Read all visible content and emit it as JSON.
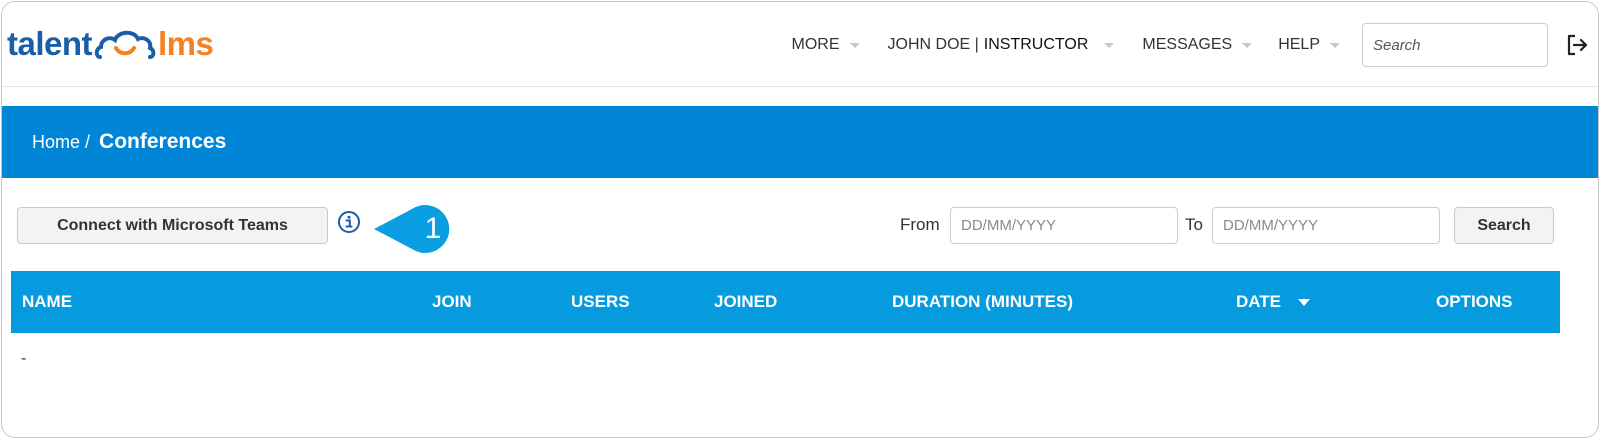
{
  "brand": {
    "part1": "talent",
    "part2": "lms",
    "color_primary": "#1a5ea8",
    "color_accent": "#f58220"
  },
  "nav": {
    "more": "MORE",
    "user": "JOHN DOE |",
    "role": "INSTRUCTOR",
    "messages": "MESSAGES",
    "help": "HELP",
    "search_placeholder": "Search",
    "logout_icon": "logout-icon"
  },
  "breadcrumb": {
    "home": "Home /",
    "current": "Conferences"
  },
  "toolbar": {
    "connect_label": "Connect with Microsoft Teams",
    "info_icon": "info-icon",
    "callout_number": "1",
    "from_label": "From",
    "from_placeholder": "DD/MM/YYYY",
    "to_label": "To",
    "to_placeholder": "DD/MM/YYYY",
    "search_label": "Search"
  },
  "table": {
    "columns": [
      "NAME",
      "JOIN",
      "USERS",
      "JOINED",
      "DURATION (MINUTES)",
      "DATE",
      "OPTIONS"
    ],
    "empty_text": "-"
  },
  "colors": {
    "banner": "#0185d6",
    "table_header": "#059bde",
    "callout": "#0a9ee2"
  }
}
